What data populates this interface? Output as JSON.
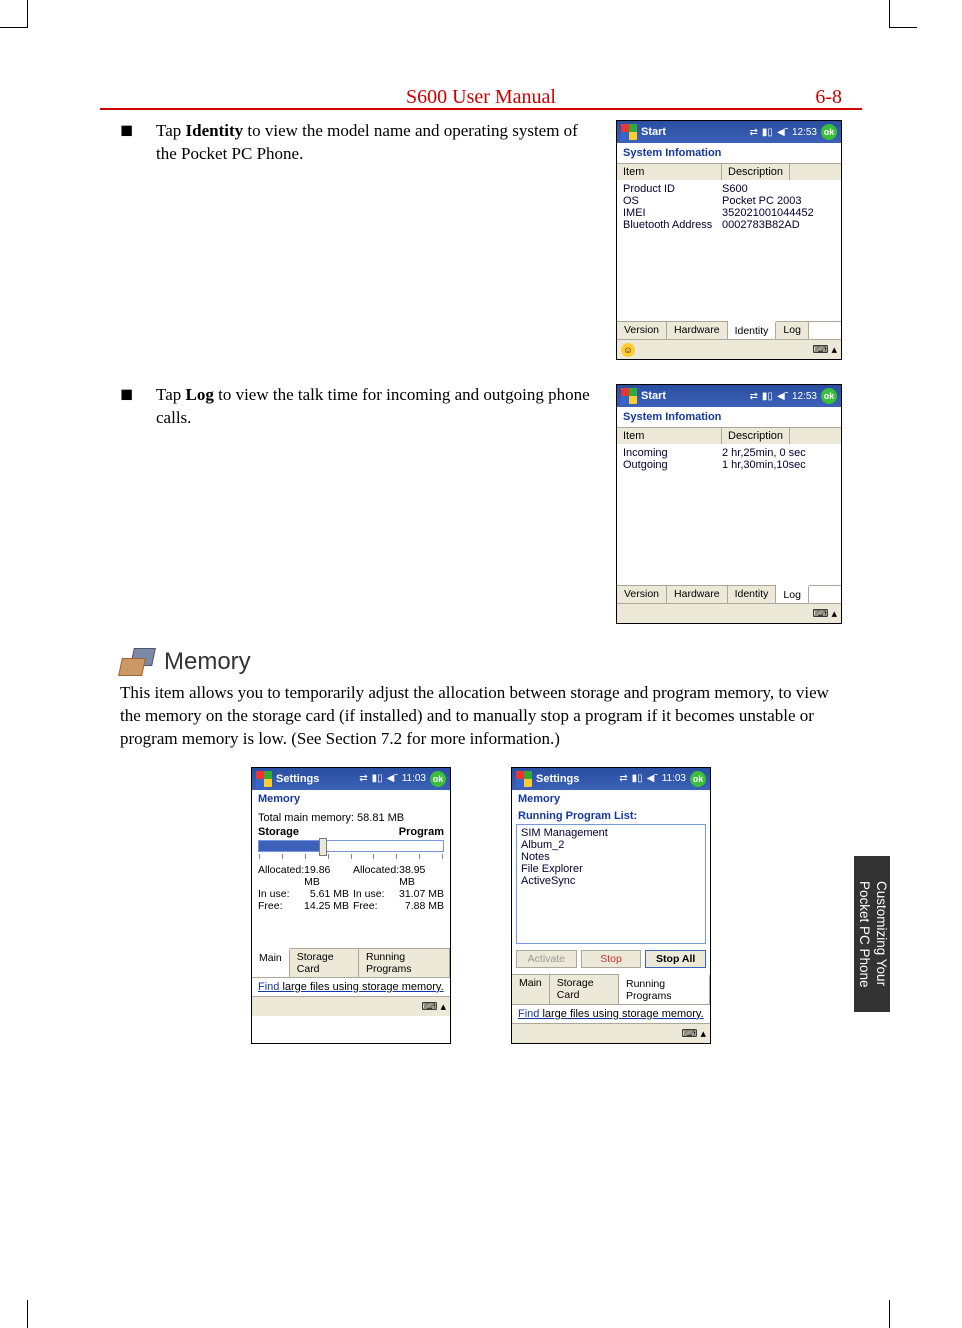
{
  "header": {
    "title": "S600 User Manual",
    "page": "6-8"
  },
  "sidetab": {
    "line1": "Customizing Your",
    "line2": "Pocket PC Phone"
  },
  "step_identity": {
    "pre": "Tap ",
    "bold": "Identity",
    "post": " to view the model name and operating system of the Pocket PC Phone."
  },
  "step_log": {
    "pre": "Tap ",
    "bold": "Log",
    "post": " to view the talk time for incoming and outgoing phone calls."
  },
  "memory": {
    "heading": "Memory",
    "desc": "This item allows you to temporarily adjust the allocation between storage and program memory, to view the memory on the storage card (if installed) and to manually stop a program if it becomes unstable or program memory is low. (See Section 7.2 for more information.)"
  },
  "shot_identity": {
    "start": "Start",
    "time": "12:53",
    "ok": "ok",
    "subtitle": "System Infomation",
    "col1": "Item",
    "col2": "Description",
    "rows": [
      {
        "item": "Product ID",
        "desc": "S600"
      },
      {
        "item": "OS",
        "desc": "Pocket PC 2003"
      },
      {
        "item": "IMEI",
        "desc": "352021001044452"
      },
      {
        "item": "Bluetooth Address",
        "desc": "0002783B82AD"
      }
    ],
    "tabs": {
      "version": "Version",
      "hardware": "Hardware",
      "identity": "Identity",
      "log": "Log"
    }
  },
  "shot_log": {
    "start": "Start",
    "time": "12:53",
    "ok": "ok",
    "subtitle": "System Infomation",
    "col1": "Item",
    "col2": "Description",
    "rows": [
      {
        "item": "Incoming",
        "desc": "2 hr,25min, 0 sec"
      },
      {
        "item": "Outgoing",
        "desc": "1 hr,30min,10sec"
      }
    ],
    "tabs": {
      "version": "Version",
      "hardware": "Hardware",
      "identity": "Identity",
      "log": "Log"
    }
  },
  "shot_mem_main": {
    "start": "Settings",
    "time": "11:03",
    "ok": "ok",
    "title": "Memory",
    "total_label": "Total main memory:",
    "total_val": "58.81 MB",
    "storage": "Storage",
    "program": "Program",
    "left": {
      "alloc_l": "Allocated:",
      "alloc_v": "19.86 MB",
      "inuse_l": "In use:",
      "inuse_v": "5.61 MB",
      "free_l": "Free:",
      "free_v": "14.25 MB"
    },
    "right": {
      "alloc_l": "Allocated:",
      "alloc_v": "38.95 MB",
      "inuse_l": "In use:",
      "inuse_v": "31.07 MB",
      "free_l": "Free:",
      "free_v": "7.88 MB"
    },
    "tabs": {
      "main": "Main",
      "sc": "Storage Card",
      "rp": "Running Programs"
    },
    "find_link": "Find",
    "find_rest": " large files using storage memory."
  },
  "shot_mem_rp": {
    "start": "Settings",
    "time": "11:03",
    "ok": "ok",
    "title": "Memory",
    "list_label": "Running Program List:",
    "items": [
      "SIM Management",
      "Album_2",
      "Notes",
      "File Explorer",
      "ActiveSync"
    ],
    "btn_activate": "Activate",
    "btn_stop": "Stop",
    "btn_stopall": "Stop All",
    "tabs": {
      "main": "Main",
      "sc": "Storage Card",
      "rp": "Running Programs"
    },
    "find_link": "Find",
    "find_rest": " large files using storage memory."
  }
}
